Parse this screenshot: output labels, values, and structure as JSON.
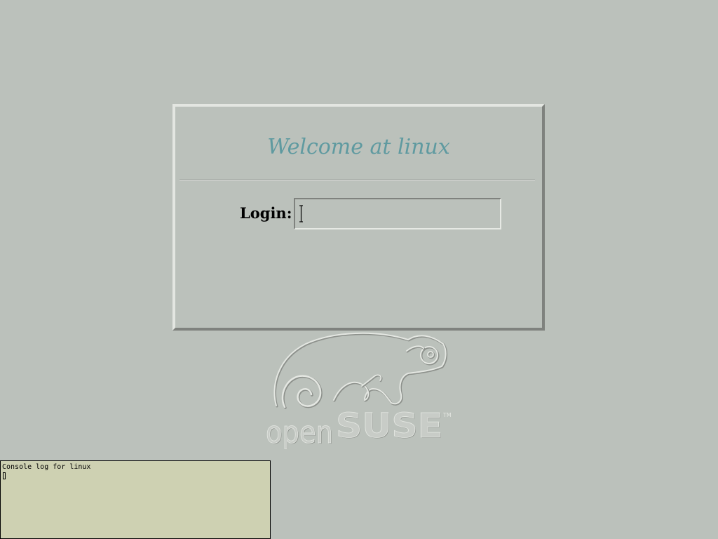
{
  "greeter": {
    "greeting": "Welcome at linux",
    "login_label": "Login:",
    "login_value": "",
    "login_placeholder": ""
  },
  "logo": {
    "brand": "openSUSE",
    "trademark": "TM"
  },
  "console": {
    "title": "Console log for linux"
  },
  "colors": {
    "background": "#bbc1bb",
    "greeting": "#5f9aa0",
    "console_background": "#ced1b2"
  }
}
